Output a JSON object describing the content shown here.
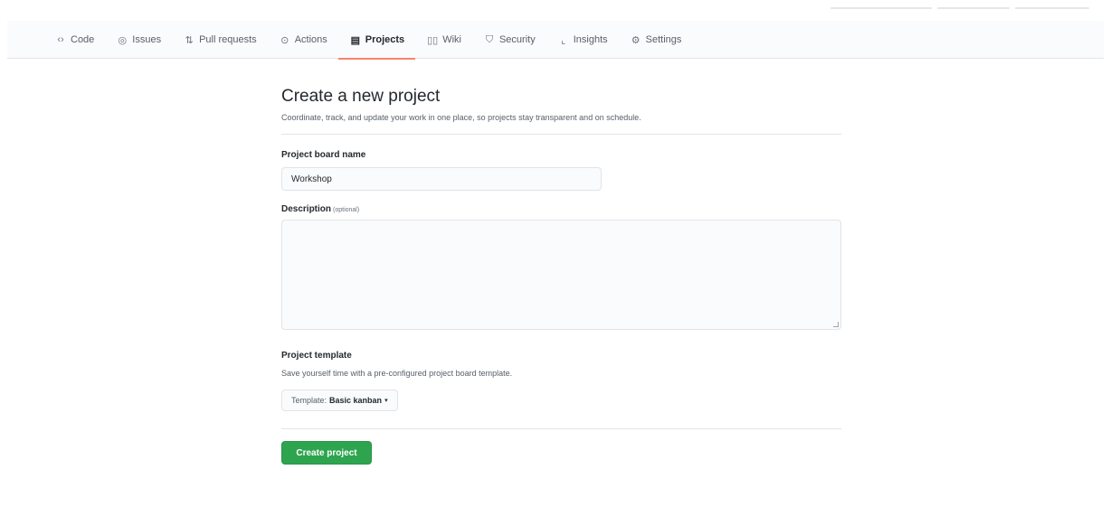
{
  "nav": {
    "tabs": [
      {
        "label": "Code",
        "icon": "code-icon",
        "glyph": "‹›"
      },
      {
        "label": "Issues",
        "icon": "issue-icon",
        "glyph": "◎"
      },
      {
        "label": "Pull requests",
        "icon": "pull-request-icon",
        "glyph": "⇅"
      },
      {
        "label": "Actions",
        "icon": "play-icon",
        "glyph": "⊙"
      },
      {
        "label": "Projects",
        "icon": "project-icon",
        "glyph": "▤"
      },
      {
        "label": "Wiki",
        "icon": "book-icon",
        "glyph": "▯▯"
      },
      {
        "label": "Security",
        "icon": "shield-icon",
        "glyph": "⛉"
      },
      {
        "label": "Insights",
        "icon": "graph-icon",
        "glyph": "⌞"
      },
      {
        "label": "Settings",
        "icon": "gear-icon",
        "glyph": "⚙"
      }
    ],
    "selected": "Projects",
    "selected_accent": "#f9826c"
  },
  "form": {
    "title": "Create a new project",
    "subtitle": "Coordinate, track, and update your work in one place, so projects stay transparent and on schedule.",
    "name_label": "Project board name",
    "name_value": "Workshop",
    "description_label": "Description",
    "description_optional": "(optional)",
    "description_value": "",
    "template_label": "Project template",
    "template_note": "Save yourself time with a pre-configured project board template.",
    "template_prefix": "Template:",
    "template_value": "Basic kanban",
    "submit_label": "Create project",
    "submit_color": "#2ea44f"
  }
}
